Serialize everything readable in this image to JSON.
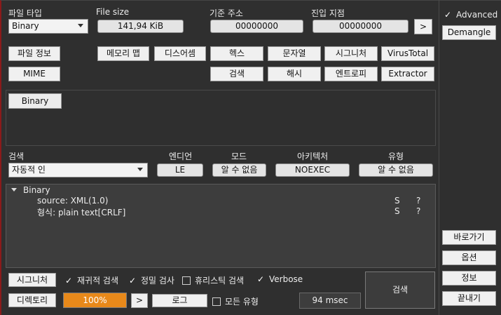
{
  "top": {
    "file_type_label": "파일 타입",
    "file_type_value": "Binary",
    "file_size_label": "File size",
    "file_size_value": "141,94 KiB",
    "base_address_label": "기준 주소",
    "base_address_value": "00000000",
    "entry_point_label": "진입 지점",
    "entry_point_value": "00000000",
    "entry_go": ">"
  },
  "buttons": {
    "file_info": "파일 정보",
    "memory_map": "메모리 맵",
    "disasm": "디스어셈",
    "hex": "헥스",
    "strings": "문자열",
    "signatures": "시그니처",
    "virustotal": "VirusTotal",
    "mime": "MIME",
    "search": "검색",
    "hash": "해시",
    "entropy": "엔트로피",
    "extractor": "Extractor"
  },
  "filetype_tab": "Binary",
  "scan_opts": {
    "search_label": "검색",
    "search_value": "자동적 인",
    "endian_label": "엔디언",
    "endian_value": "LE",
    "mode_label": "모드",
    "mode_value": "알 수 없음",
    "arch_label": "아키텍처",
    "arch_value": "NOEXEC",
    "type_label": "유형",
    "type_value": "알 수 없음"
  },
  "results": {
    "root": "Binary",
    "rows": [
      {
        "text": "source: XML(1.0)",
        "flag": "S",
        "q": "?"
      },
      {
        "text": "형식: plain text[CRLF]",
        "flag": "S",
        "q": "?"
      }
    ]
  },
  "bottom": {
    "signatures_button": "시그니처",
    "recursive": "재귀적 검색",
    "deep": "정밀 검사",
    "heuristic": "휴리스틱 검색",
    "verbose": "Verbose",
    "directory_button": "디렉토리",
    "progress_text": "100%",
    "progress_value": 100,
    "progress_go": ">",
    "log_button": "로그",
    "all_types": "모든 유형",
    "time": "94 msec",
    "scan_button": "검색"
  },
  "side": {
    "advanced": "Advanced",
    "demangle": "Demangle",
    "shortcut": "바로가기",
    "options": "옵션",
    "about": "정보",
    "exit": "끝내기"
  },
  "colors": {
    "accent": "#e8891a",
    "background": "#2f2f2f",
    "border_accent": "#8b1a1a"
  }
}
